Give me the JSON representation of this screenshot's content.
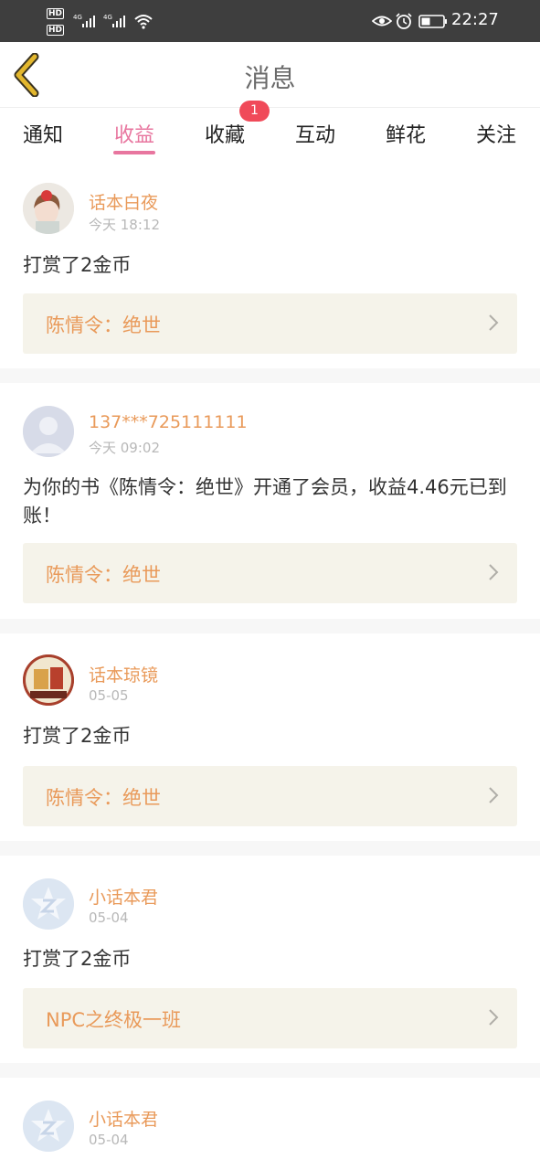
{
  "status_bar": {
    "hd1": "HD",
    "hd2": "HD",
    "net1": "4G",
    "net2": "4G",
    "time": "22:27"
  },
  "header": {
    "title": "消息"
  },
  "tabs": [
    {
      "label": "通知"
    },
    {
      "label": "收益"
    },
    {
      "label": "收藏"
    },
    {
      "label": "互动"
    },
    {
      "label": "鲜花"
    },
    {
      "label": "关注"
    }
  ],
  "active_tab": "收益",
  "favorites_badge": "1",
  "messages": [
    {
      "sender": "话本白夜",
      "time": "今天 18:12",
      "text": "打赏了2金币",
      "book": "陈情令：绝世"
    },
    {
      "sender": "137***725111111",
      "time": "今天 09:02",
      "text": "为你的书《陈情令：绝世》开通了会员，收益4.46元已到账！",
      "book": "陈情令：绝世"
    },
    {
      "sender": "话本琼镜",
      "time": "05-05",
      "text": "打赏了2金币",
      "book": "陈情令：绝世"
    },
    {
      "sender": "小话本君",
      "time": "05-04",
      "text": "打赏了2金币",
      "book": "NPC之终极一班"
    },
    {
      "sender": "小话本君",
      "time": "05-04"
    }
  ],
  "colors": {
    "accent": "#e8769f",
    "name": "#e99a5a",
    "badge": "#f04a59",
    "back_arrow": "#e3b72d",
    "book_bg": "#f5f3ea"
  }
}
